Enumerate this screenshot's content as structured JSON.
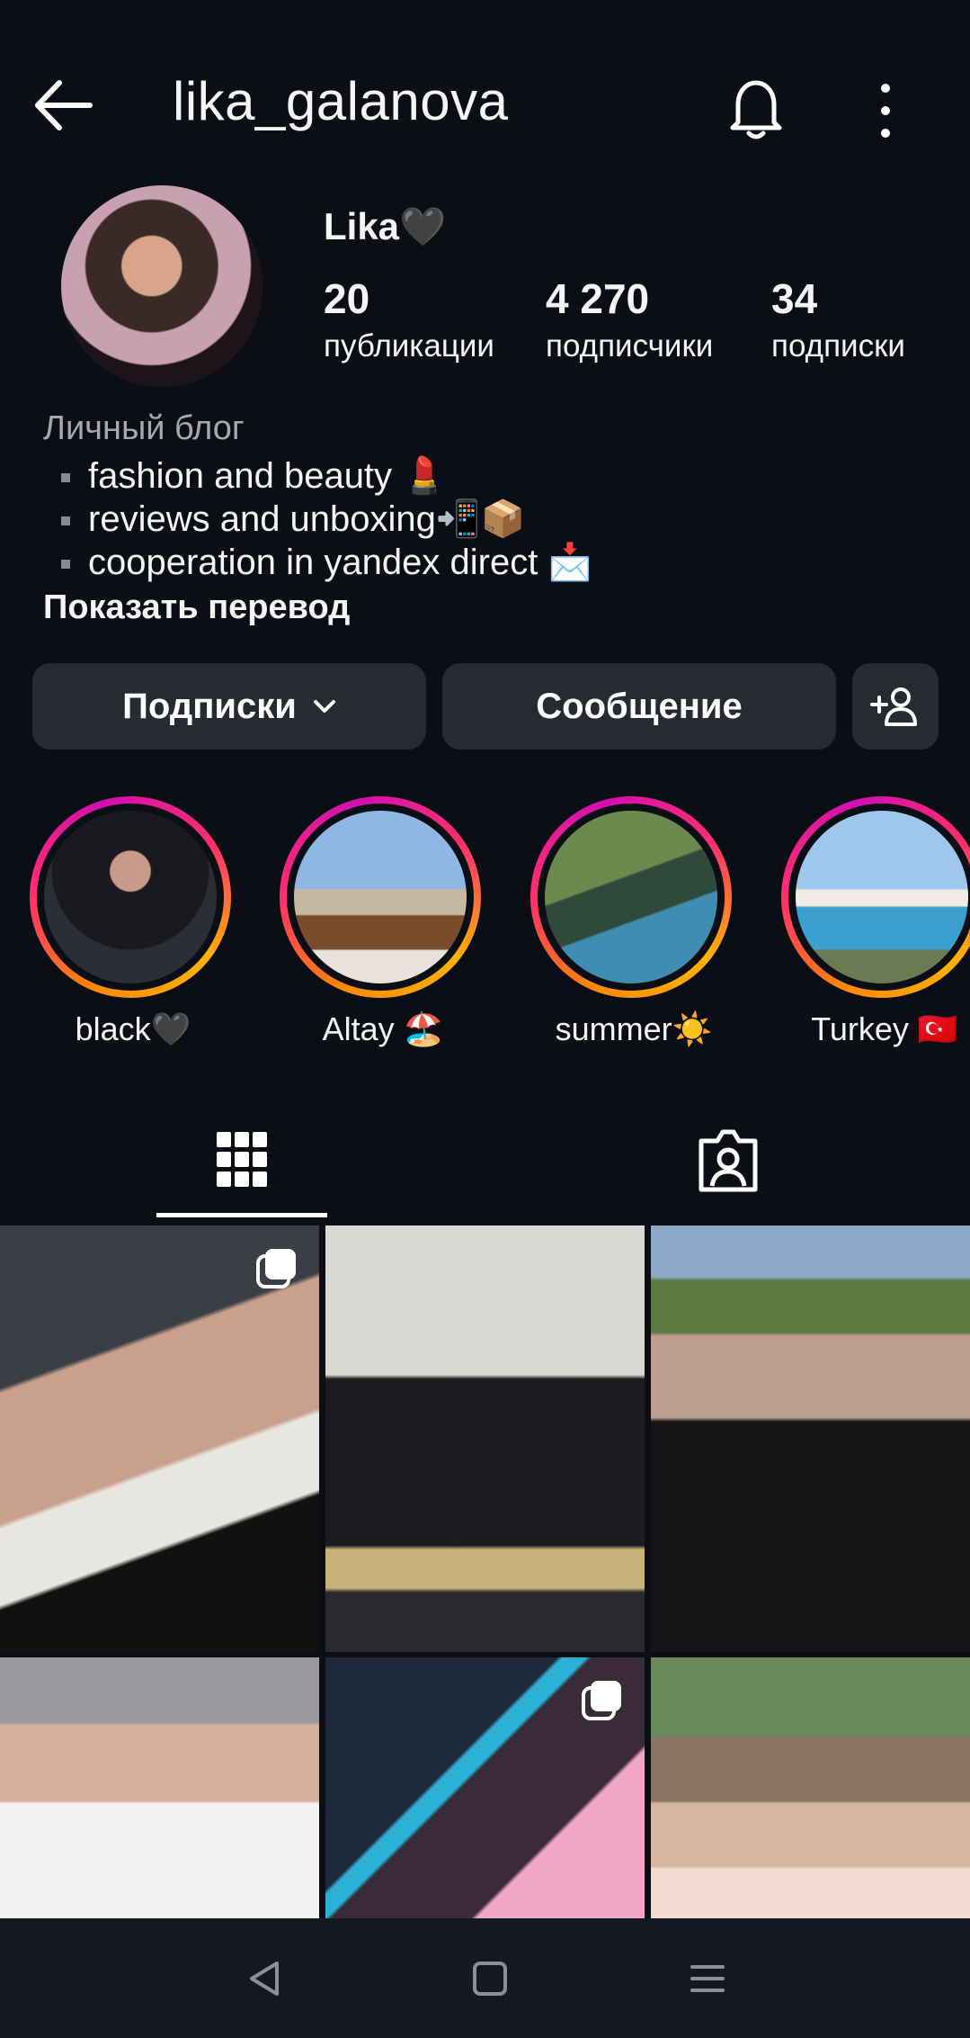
{
  "header": {
    "username": "lika_galanova"
  },
  "profile": {
    "display_name": "Lika🖤",
    "stats": [
      {
        "value": "20",
        "label": "публикации"
      },
      {
        "value": "4 270",
        "label": "подписчики"
      },
      {
        "value": "34",
        "label": "подписки"
      }
    ],
    "category": "Личный блог",
    "bio": [
      "fashion and beauty 💄",
      "reviews and unboxing📲📦",
      "cooperation in yandex direct 📩"
    ],
    "show_translation": "Показать перевод"
  },
  "actions": {
    "following_label": "Подписки",
    "message_label": "Сообщение"
  },
  "highlights": [
    {
      "label": "black🖤"
    },
    {
      "label": "Altay 🏖️"
    },
    {
      "label": "summer☀️"
    },
    {
      "label": "Turkey 🇹🇷"
    }
  ],
  "icons": {
    "back": "arrow-left-icon",
    "notifications": "bell-icon",
    "more": "more-vertical-icon",
    "add_user": "add-user-icon",
    "grid_tab": "grid-icon",
    "tagged_tab": "tagged-person-icon",
    "multi_post": "multiple-photos-icon"
  },
  "colors": {
    "background": "#0b0f15",
    "button_bg": "#262a31",
    "ring_orange": "#ff8a00",
    "ring_pink": "#ff2d6f",
    "ring_magenta": "#d10fb3"
  }
}
